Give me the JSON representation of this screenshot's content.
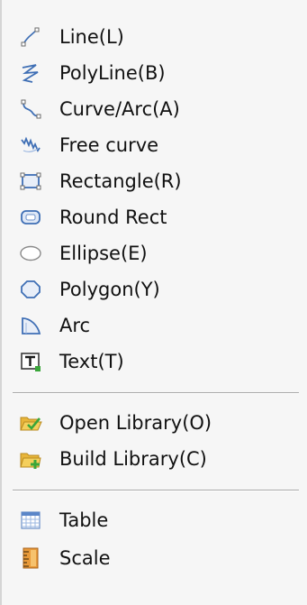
{
  "menu": {
    "items": [
      {
        "label": "Line(L)",
        "icon": "line-icon"
      },
      {
        "label": "PolyLine(B)",
        "icon": "polyline-icon"
      },
      {
        "label": "Curve/Arc(A)",
        "icon": "curve-arc-icon"
      },
      {
        "label": "Free curve",
        "icon": "free-curve-icon"
      },
      {
        "label": "Rectangle(R)",
        "icon": "rectangle-icon"
      },
      {
        "label": "Round Rect",
        "icon": "round-rect-icon"
      },
      {
        "label": "Ellipse(E)",
        "icon": "ellipse-icon"
      },
      {
        "label": "Polygon(Y)",
        "icon": "polygon-icon"
      },
      {
        "label": "Arc",
        "icon": "arc-icon"
      },
      {
        "label": "Text(T)",
        "icon": "text-icon"
      },
      {
        "label": "Open Library(O)",
        "icon": "open-library-icon"
      },
      {
        "label": "Build Library(C)",
        "icon": "build-library-icon"
      },
      {
        "label": "Table",
        "icon": "table-icon"
      },
      {
        "label": "Scale",
        "icon": "scale-icon"
      }
    ]
  },
  "colors": {
    "menu_background": "#f6f6f6",
    "icon_blue": "#3f6fb5",
    "folder_yellow": "#e8b53a",
    "check_green": "#3aa63a",
    "separator": "#a9a9a9"
  }
}
